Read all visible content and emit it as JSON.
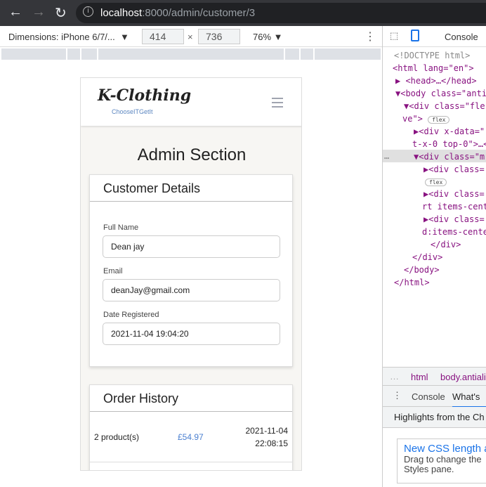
{
  "browser": {
    "url_host": "localhost",
    "url_path": ":8000/admin/customer/3"
  },
  "device_toolbar": {
    "dimensions": "Dimensions: iPhone 6/7/...",
    "width": "414",
    "height": "736",
    "times": "×",
    "zoom": "76%"
  },
  "site": {
    "logo": "K-Clothing",
    "tagline": "ChooseITGetIt",
    "heading": "Admin Section",
    "customer": {
      "title": "Customer Details",
      "fields": [
        {
          "label": "Full Name",
          "value": "Dean jay"
        },
        {
          "label": "Email",
          "value": "deanJay@gmail.com"
        },
        {
          "label": "Date Registered",
          "value": "2021-11-04 19:04:20"
        }
      ]
    },
    "orders": {
      "title": "Order History",
      "rows": [
        {
          "products": "2 product(s)",
          "total": "£54.97",
          "date": "2021-11-04",
          "time": "22:08:15"
        }
      ]
    }
  },
  "devtools": {
    "console_tab": "Console",
    "lines": [
      "<!DOCTYPE html>",
      "<html lang=\"en\">",
      "<head>…</head>",
      "<body class=\"anti",
      "<div class=\"fle",
      "ve\">",
      "flex",
      "<div x-data=\"",
      "t-x-0 top-0\">…<",
      "<div class=\"m",
      "<div class=",
      "flex",
      "<div class=",
      "rt items-cent",
      "<div class=",
      "d:items-cente",
      "</div>",
      "</div>",
      "</body>",
      "</html>"
    ],
    "breadcrumbs": [
      "html",
      "body.antiali"
    ],
    "drawer_tabs": [
      "Console",
      "What's"
    ],
    "highlights": "Highlights from the Ch",
    "tip_title": "New CSS length a",
    "tip_text": "Drag to change the Styles pane."
  }
}
